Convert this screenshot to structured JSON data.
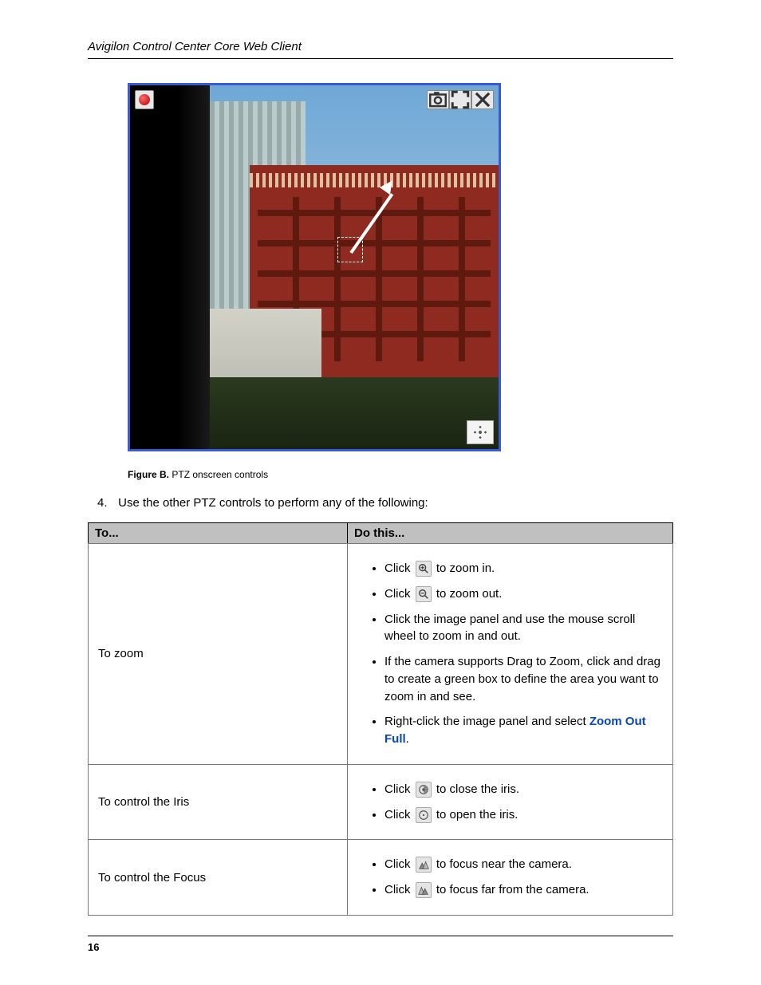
{
  "header": "Avigilon Control Center Core Web Client",
  "figure": {
    "label": "Figure B.",
    "caption": "PTZ onscreen controls",
    "icons": {
      "record": "record-icon",
      "snapshot": "snapshot-icon",
      "fullscreen": "fullscreen-icon",
      "close": "close-icon",
      "ptz": "ptz-icon"
    }
  },
  "step": {
    "number": "4.",
    "text": "Use the other PTZ controls to perform any of the following:"
  },
  "table": {
    "headers": {
      "to": "To...",
      "do": "Do this..."
    },
    "rows": [
      {
        "to": "To zoom",
        "items": [
          {
            "pre": "Click ",
            "icon": "zoom-in-icon",
            "post": " to zoom in."
          },
          {
            "pre": "Click ",
            "icon": "zoom-out-icon",
            "post": " to zoom out."
          },
          {
            "text": "Click the image panel and use the mouse scroll wheel to zoom in and out."
          },
          {
            "text": "If the camera supports Drag to Zoom, click and drag to create a green box to define the area you want to zoom in and see."
          },
          {
            "pre": "Right-click the image panel and select ",
            "link": "Zoom Out Full",
            "post": "."
          }
        ]
      },
      {
        "to": "To control the Iris",
        "items": [
          {
            "pre": "Click ",
            "icon": "iris-close-icon",
            "post": " to close the iris."
          },
          {
            "pre": "Click ",
            "icon": "iris-open-icon",
            "post": " to open the iris."
          }
        ]
      },
      {
        "to": "To control the Focus",
        "items": [
          {
            "pre": "Click ",
            "icon": "focus-near-icon",
            "post": " to focus near the camera."
          },
          {
            "pre": "Click ",
            "icon": "focus-far-icon",
            "post": " to focus far from the camera."
          }
        ]
      }
    ]
  },
  "page_number": "16"
}
